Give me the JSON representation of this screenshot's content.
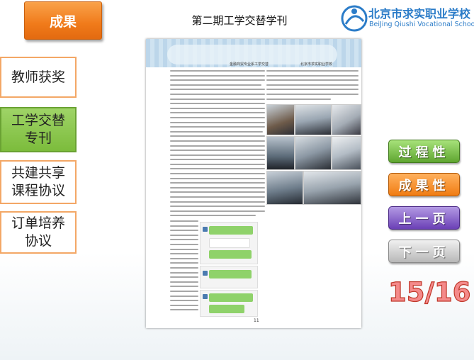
{
  "header": {
    "top_button": "成果",
    "doc_title": "第二期工学交替学刊"
  },
  "logo": {
    "name": "北京市求实职业学校",
    "english": "BeiJing Qiushi Vocational School"
  },
  "sidebar": {
    "items": [
      {
        "label": "教师获奖"
      },
      {
        "label": "工学交替\n专刊"
      },
      {
        "label": "共建共享\n课程协议"
      },
      {
        "label": "订单培养\n协议"
      }
    ]
  },
  "document": {
    "head_left": "金融商贸专业系工学交替",
    "head_right": "北京市求实职业学校",
    "page_number": "11"
  },
  "nav": {
    "process": "过程性",
    "result": "成果性",
    "prev": "上一页",
    "next": "下一页"
  },
  "pager": {
    "counter": "15/16"
  },
  "colors": {
    "orange": "#f07a1a",
    "green": "#7cbc3c",
    "purple": "#6b40b6",
    "gray": "#b8b8b8",
    "counter": "#f48a8a"
  }
}
